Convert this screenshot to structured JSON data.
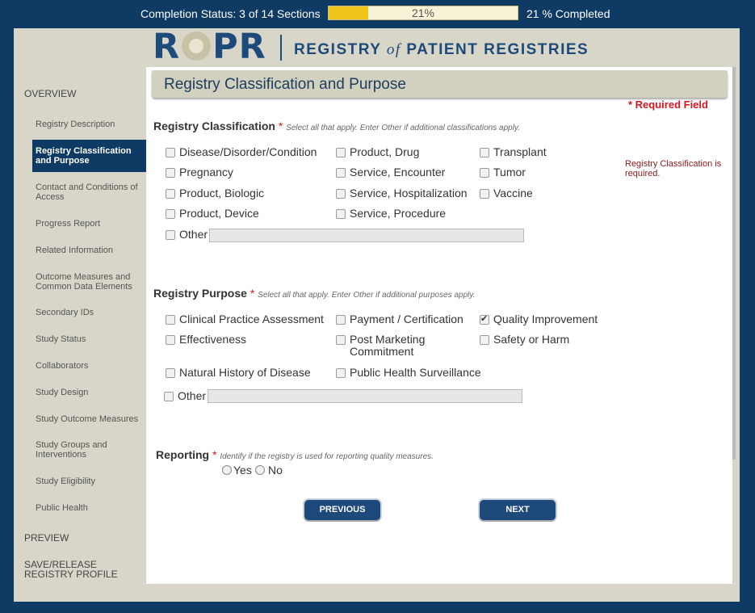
{
  "progress": {
    "status_text": "Completion Status: 3 of 14 Sections",
    "bar_text": "21%",
    "fill_percent": 21,
    "completed_text": "21 % Completed"
  },
  "logo": {
    "letters_r": "R",
    "letters_pr": "PR",
    "tag_pre": "REGISTRY ",
    "tag_of": "of",
    "tag_post": " PATIENT REGISTRIES"
  },
  "sidebar": {
    "overview": "OVERVIEW",
    "items": [
      {
        "label": "Registry Description"
      },
      {
        "label": "Registry Classification and Purpose"
      },
      {
        "label": "Contact and Conditions of Access"
      },
      {
        "label": "Progress Report"
      },
      {
        "label": "Related Information"
      },
      {
        "label": "Outcome Measures and Common Data Elements"
      },
      {
        "label": "Secondary IDs"
      },
      {
        "label": "Study Status"
      },
      {
        "label": "Collaborators"
      },
      {
        "label": "Study Design"
      },
      {
        "label": "Study Outcome Measures"
      },
      {
        "label": "Study Groups and Interventions"
      },
      {
        "label": "Study Eligibility"
      },
      {
        "label": "Public Health"
      }
    ],
    "preview": "PREVIEW",
    "save_release": "SAVE/RELEASE REGISTRY PROFILE"
  },
  "page": {
    "title": "Registry Classification and Purpose",
    "required_note": "* Required Field"
  },
  "classification": {
    "heading": "Registry Classification",
    "star": "*",
    "hint": "Select all that apply. Enter Other if additional classifications apply.",
    "options": [
      {
        "label": "Disease/Disorder/Condition",
        "checked": false
      },
      {
        "label": "Pregnancy",
        "checked": false
      },
      {
        "label": "Product, Biologic",
        "checked": false
      },
      {
        "label": "Product, Device",
        "checked": false
      },
      {
        "label": "Product, Drug",
        "checked": false
      },
      {
        "label": "Service, Encounter",
        "checked": false
      },
      {
        "label": "Service, Hospitalization",
        "checked": false
      },
      {
        "label": "Service, Procedure",
        "checked": false
      },
      {
        "label": "Transplant",
        "checked": false
      },
      {
        "label": "Tumor",
        "checked": false
      },
      {
        "label": "Vaccine",
        "checked": false
      }
    ],
    "other_label": "Other",
    "other_value": "",
    "error": "Registry Classification is required."
  },
  "purpose": {
    "heading": "Registry Purpose",
    "star": "*",
    "hint": "Select all that apply. Enter Other if additional purposes apply.",
    "options": [
      {
        "label": "Clinical Practice Assessment",
        "checked": false
      },
      {
        "label": "Effectiveness",
        "checked": false
      },
      {
        "label": "Natural History of Disease",
        "checked": false
      },
      {
        "label": "Payment / Certification",
        "checked": false
      },
      {
        "label": "Post Marketing Commitment",
        "checked": false
      },
      {
        "label": "Public Health Surveillance",
        "checked": false
      },
      {
        "label": "Quality Improvement",
        "checked": true
      },
      {
        "label": "Safety or Harm",
        "checked": false
      }
    ],
    "other_label": "Other",
    "other_value": ""
  },
  "reporting": {
    "heading": "Reporting",
    "star": "*",
    "hint": "Identify if the registry is used for reporting quality measures.",
    "yes": "Yes",
    "no": "No"
  },
  "nav": {
    "previous": "PREVIOUS",
    "next": "NEXT"
  }
}
